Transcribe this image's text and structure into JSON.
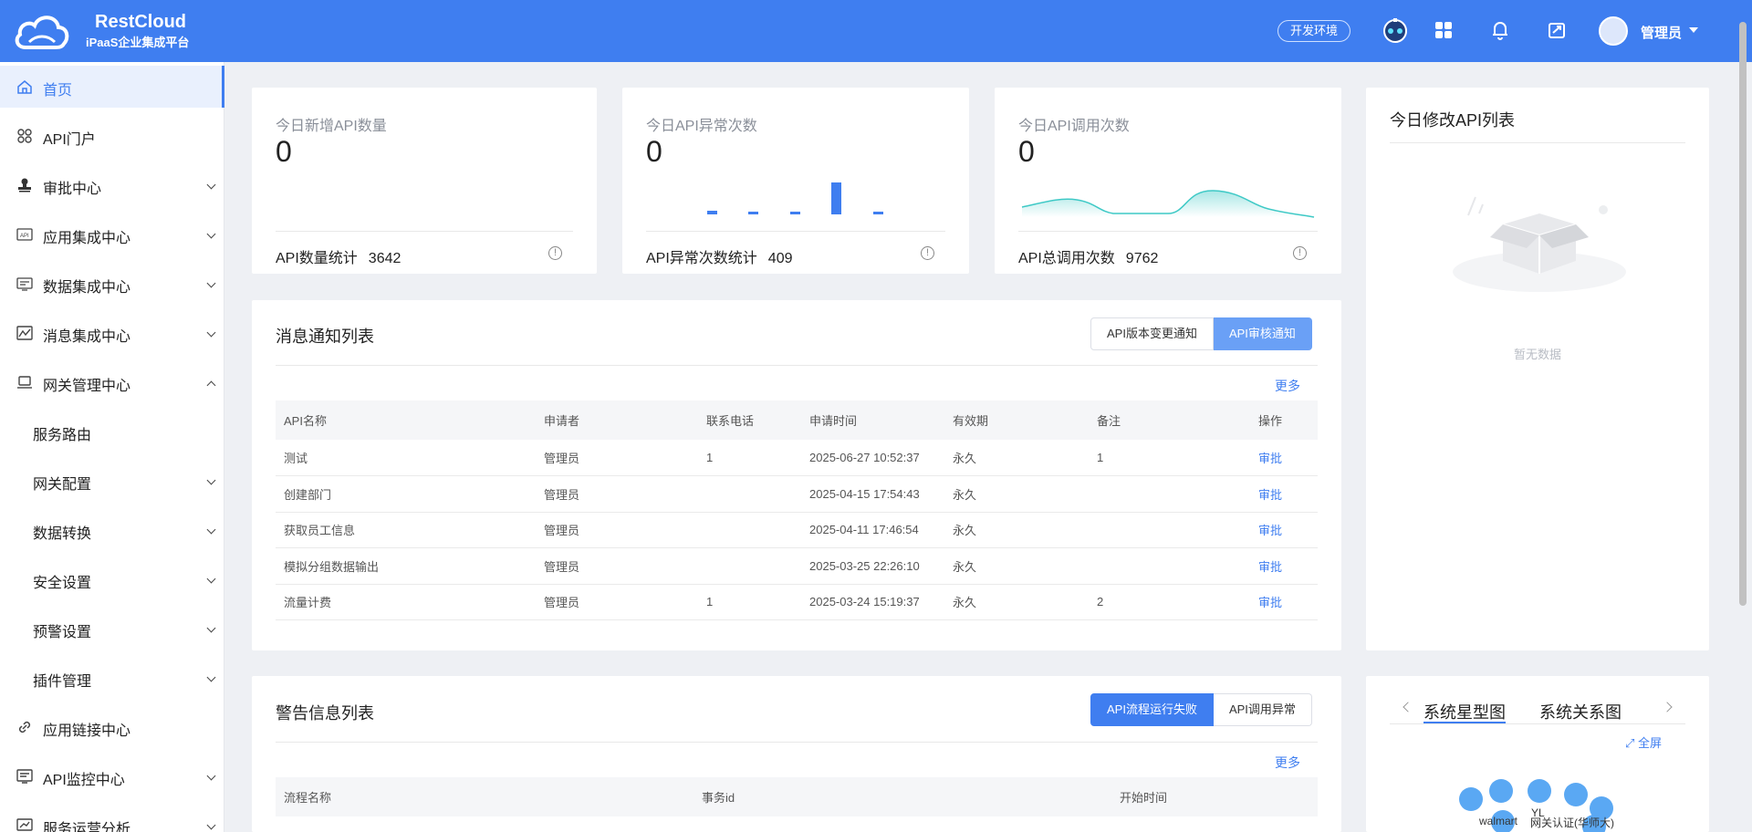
{
  "header": {
    "brand": "RestCloud",
    "subtitle": "iPaaS企业集成平台",
    "env": "开发环境",
    "user": "管理员"
  },
  "sidebar": {
    "items": [
      {
        "label": "首页"
      },
      {
        "label": "API门户"
      },
      {
        "label": "审批中心"
      },
      {
        "label": "应用集成中心"
      },
      {
        "label": "数据集成中心"
      },
      {
        "label": "消息集成中心"
      },
      {
        "label": "网关管理中心"
      },
      {
        "label": "服务路由"
      },
      {
        "label": "网关配置"
      },
      {
        "label": "数据转换"
      },
      {
        "label": "安全设置"
      },
      {
        "label": "预警设置"
      },
      {
        "label": "插件管理"
      },
      {
        "label": "应用链接中心"
      },
      {
        "label": "API监控中心"
      },
      {
        "label": "服务运营分析"
      }
    ]
  },
  "stats": [
    {
      "title": "今日新增API数量",
      "value": "0",
      "foot_label": "API数量统计",
      "foot_value": "3642"
    },
    {
      "title": "今日API异常次数",
      "value": "0",
      "foot_label": "API异常次数统计",
      "foot_value": "409"
    },
    {
      "title": "今日API调用次数",
      "value": "0",
      "foot_label": "API总调用次数",
      "foot_value": "9762"
    }
  ],
  "colors": {
    "accent": "#3f7ef0",
    "sparkline": "#3ec9c6"
  },
  "modified_panel": {
    "title": "今日修改API列表",
    "empty": "暂无数据"
  },
  "notify": {
    "title": "消息通知列表",
    "tabs": [
      "API版本变更通知",
      "API审核通知"
    ],
    "more": "更多",
    "columns": [
      "API名称",
      "申请者",
      "联系电话",
      "申请时间",
      "有效期",
      "备注",
      "操作"
    ],
    "rows": [
      [
        "测试",
        "管理员",
        "1",
        "2025-06-27 10:52:37",
        "永久",
        "1",
        "审批"
      ],
      [
        "创建部门",
        "管理员",
        "",
        "2025-04-15 17:54:43",
        "永久",
        "",
        "审批"
      ],
      [
        "获取员工信息",
        "管理员",
        "",
        "2025-04-11 17:46:54",
        "永久",
        "",
        "审批"
      ],
      [
        "模拟分组数据输出",
        "管理员",
        "",
        "2025-03-25 22:26:10",
        "永久",
        "",
        "审批"
      ],
      [
        "流量计费",
        "管理员",
        "1",
        "2025-03-24 15:19:37",
        "永久",
        "2",
        "审批"
      ]
    ]
  },
  "warning": {
    "title": "警告信息列表",
    "tabs": [
      "API流程运行失败",
      "API调用异常"
    ],
    "more": "更多",
    "columns": [
      "流程名称",
      "事务id",
      "开始时间"
    ]
  },
  "graph": {
    "tabs": [
      "系统星型图",
      "系统关系图"
    ],
    "fullscreen": "全屏",
    "labels": [
      "YL",
      "walmart",
      "网关认证(华师大)"
    ]
  }
}
